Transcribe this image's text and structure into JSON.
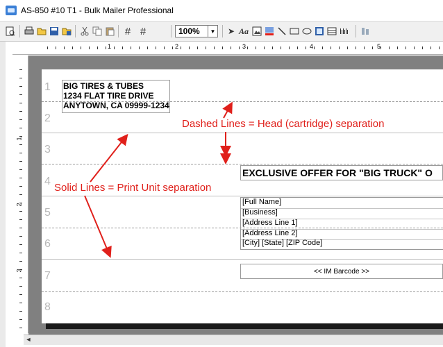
{
  "window": {
    "title": "AS-850 #10 T1 - Bulk Mailer Professional"
  },
  "toolbar": {
    "zoom_value": "100%",
    "icons": [
      "print-preview-icon",
      "print-icon",
      "open-icon",
      "save-icon",
      "export-icon",
      "cut-icon",
      "copy-icon",
      "paste-icon",
      "grid-icon",
      "grid-alt-icon",
      "pointer-icon",
      "text-icon",
      "image-icon",
      "fill-icon",
      "line-icon",
      "rectangle-icon",
      "ellipse-icon",
      "picture-icon",
      "table-icon",
      "barcode-icon",
      "align-icon"
    ],
    "text_tool_label": "Aa"
  },
  "ruler": {
    "horizontal_labels": [
      "1",
      "2",
      "3",
      "4",
      "5",
      "6"
    ],
    "vertical_labels": [
      "1",
      "2",
      "3"
    ]
  },
  "page": {
    "row_numbers": [
      "1",
      "2",
      "3",
      "4",
      "5",
      "6",
      "7",
      "8"
    ],
    "return_address": [
      "BIG TIRES & TUBES",
      "1234 FLAT TIRE DRIVE",
      "ANYTOWN, CA 09999-1234"
    ],
    "offer_text": "EXCLUSIVE OFFER FOR \"BIG TRUCK\" O",
    "address_fields": [
      "[Full Name]",
      "[Business]",
      "[Address Line 1]",
      "[Address Line 2]",
      "[City] [State] [ZIP Code]"
    ],
    "barcode_placeholder": "<< IM Barcode >>"
  },
  "annotations": {
    "dashed_label": "Dashed Lines = Head (cartridge) separation",
    "solid_label": "Solid Lines = Print Unit separation",
    "color": "#e0201b"
  },
  "scrollbar": {
    "left_arrow": "◄"
  }
}
